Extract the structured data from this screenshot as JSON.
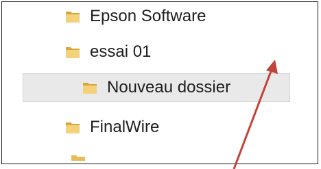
{
  "tree": {
    "items": [
      {
        "label": "Epson Software",
        "icon": "folder-icon",
        "selected": false
      },
      {
        "label": "essai 01",
        "icon": "folder-icon",
        "selected": false
      },
      {
        "label": "Nouveau dossier",
        "icon": "folder-icon",
        "selected": true
      },
      {
        "label": "FinalWire",
        "icon": "folder-icon",
        "selected": false
      }
    ]
  },
  "annotation": {
    "icon": "red-arrow-annotation",
    "color": "#c1433a"
  },
  "colors": {
    "folder_light": "#f3d27a",
    "folder_dark": "#d9a636",
    "selection_bg": "#e9e9e9"
  }
}
